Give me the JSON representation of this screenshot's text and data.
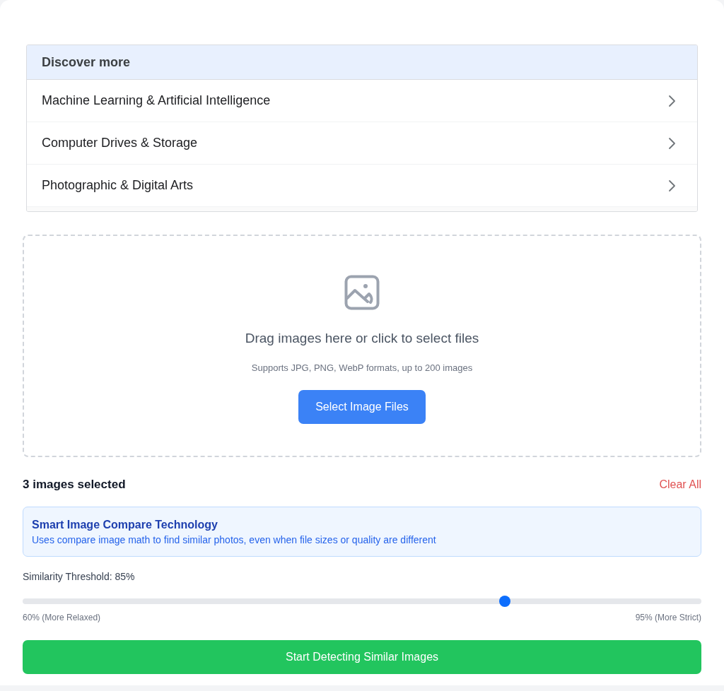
{
  "discover": {
    "title": "Discover more",
    "items": [
      {
        "label": "Machine Learning & Artificial Intelligence"
      },
      {
        "label": "Computer Drives & Storage"
      },
      {
        "label": "Photographic & Digital Arts"
      }
    ]
  },
  "upload": {
    "heading": "Drag images here or click to select files",
    "hint": "Supports JPG, PNG, WebP formats, up to 200 images",
    "button": "Select Image Files"
  },
  "selection": {
    "count": "3 images selected",
    "clear": "Clear All"
  },
  "info": {
    "title": "Smart Image Compare Technology",
    "text": "Uses compare image math to find similar photos, even when file sizes or quality are different"
  },
  "threshold": {
    "label": "Similarity Threshold: 85%",
    "level": 0.71,
    "min_label": "60% (More Relaxed)",
    "max_label": "95% (More Strict)"
  },
  "start_button": "Start Detecting Similar Images"
}
